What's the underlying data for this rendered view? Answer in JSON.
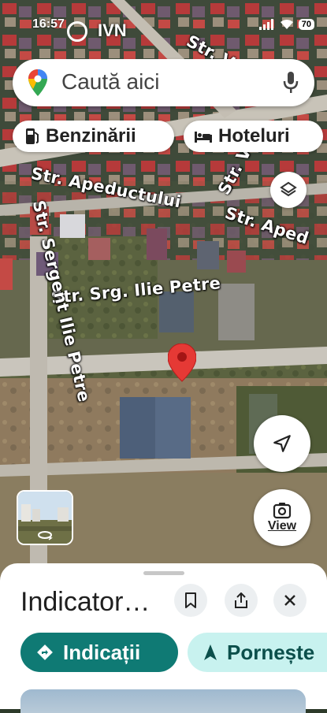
{
  "status_bar": {
    "time": "16:57",
    "carrier": "IVN",
    "battery": "70"
  },
  "search": {
    "placeholder": "Caută aici"
  },
  "chips": [
    {
      "label": "Benzinării",
      "icon": "gas-station-icon"
    },
    {
      "label": "Hoteluri",
      "icon": "hotel-bed-icon"
    }
  ],
  "map": {
    "streets": [
      "Str. Apeductului",
      "Str. Aped",
      "Str. Srg. Ilie Petre",
      "Str. Sergent Ilie Petre",
      "Str. V",
      "Str. V"
    ],
    "pin_color": "#e53935"
  },
  "controls": {
    "view_label": "View"
  },
  "place_sheet": {
    "title": "Indicator…",
    "directions_label": "Indicații",
    "start_label": "Pornește"
  },
  "colors": {
    "accent": "#0f7a74",
    "accent_light": "#c8f2ef"
  }
}
